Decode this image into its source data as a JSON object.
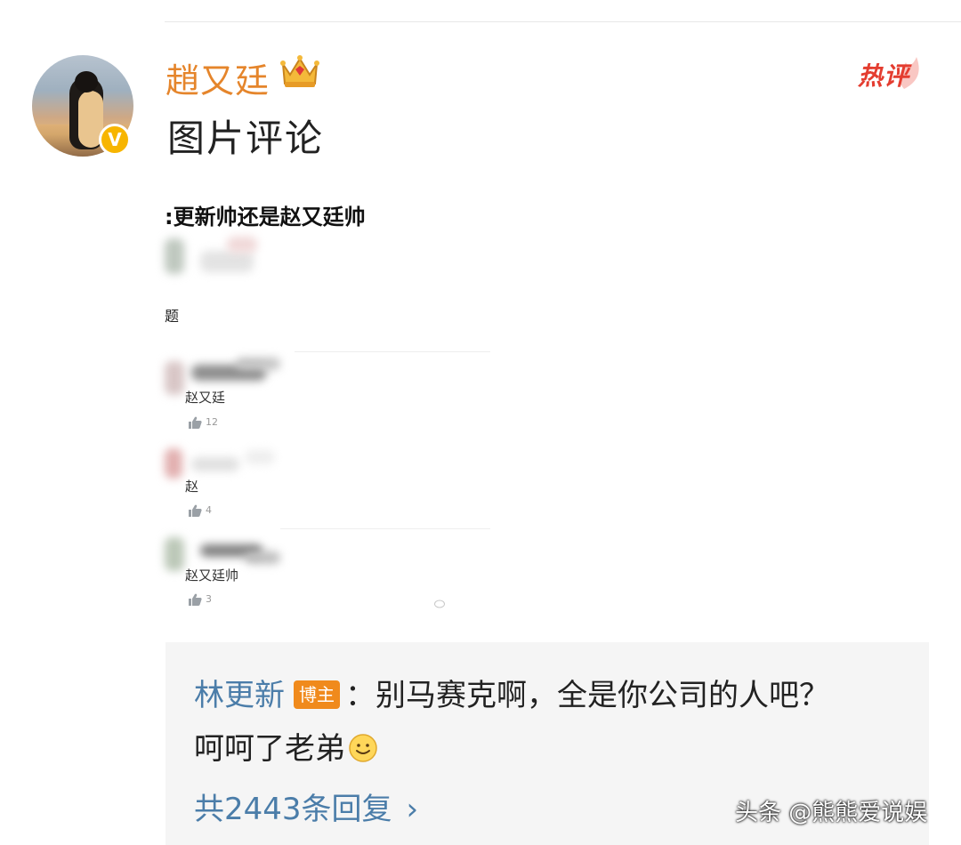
{
  "post": {
    "username": "趙又廷",
    "hot_label": "热评",
    "comment": "图片评论"
  },
  "embedded_screenshot": {
    "title": "更新帅还是赵又廷帅",
    "topic_char": "题",
    "comments": [
      {
        "name": "赵又廷",
        "likes": "12"
      },
      {
        "name": "赵",
        "likes": "4"
      },
      {
        "name": "赵又廷帅",
        "likes": "3"
      }
    ]
  },
  "reply": {
    "author": "林更新",
    "badge": "博主",
    "text_line1": "：别马赛克啊，全是你公司的人吧？",
    "text_line2": "呵呵了老弟",
    "count_label": "共2443条回复",
    "chevron": "›"
  },
  "credit": "头条 @熊熊爱说娱",
  "icons": {
    "verified": "verified-v-icon",
    "crown": "crown-icon",
    "hot": "hot-comment-icon",
    "like": "thumbs-up-icon",
    "smile": "smile-emoji-icon"
  },
  "colors": {
    "username": "#e5852b",
    "hot": "#e43d30",
    "link": "#4b7da9",
    "badge": "#f08a1c",
    "verified": "#f7b500",
    "reply_bg": "#f5f5f5"
  }
}
